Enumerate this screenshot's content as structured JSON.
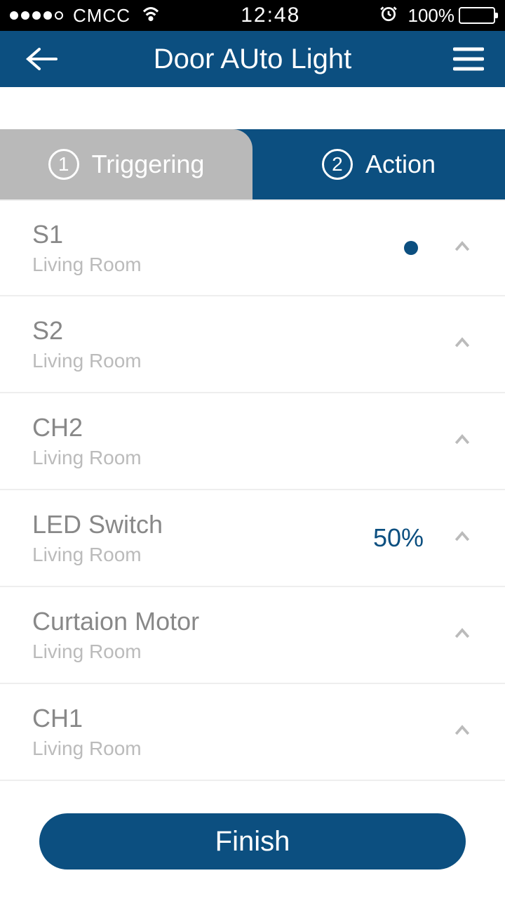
{
  "status": {
    "carrier": "CMCC",
    "time": "12:48",
    "battery_pct": "100%"
  },
  "header": {
    "title": "Door AUto Light"
  },
  "tabs": {
    "t1_num": "1",
    "t1_label": "Triggering",
    "t2_num": "2",
    "t2_label": "Action"
  },
  "rows": [
    {
      "title": "S1",
      "sub": "Living Room",
      "value": "",
      "dot": true
    },
    {
      "title": "S2",
      "sub": "Living Room",
      "value": "",
      "dot": false
    },
    {
      "title": "CH2",
      "sub": "Living Room",
      "value": "",
      "dot": false
    },
    {
      "title": "LED Switch",
      "sub": "Living Room",
      "value": "50%",
      "dot": false
    },
    {
      "title": "Curtaion Motor",
      "sub": "Living Room",
      "value": "",
      "dot": false
    },
    {
      "title": "CH1",
      "sub": "Living Room",
      "value": "",
      "dot": false
    }
  ],
  "footer": {
    "finish": "Finish"
  }
}
